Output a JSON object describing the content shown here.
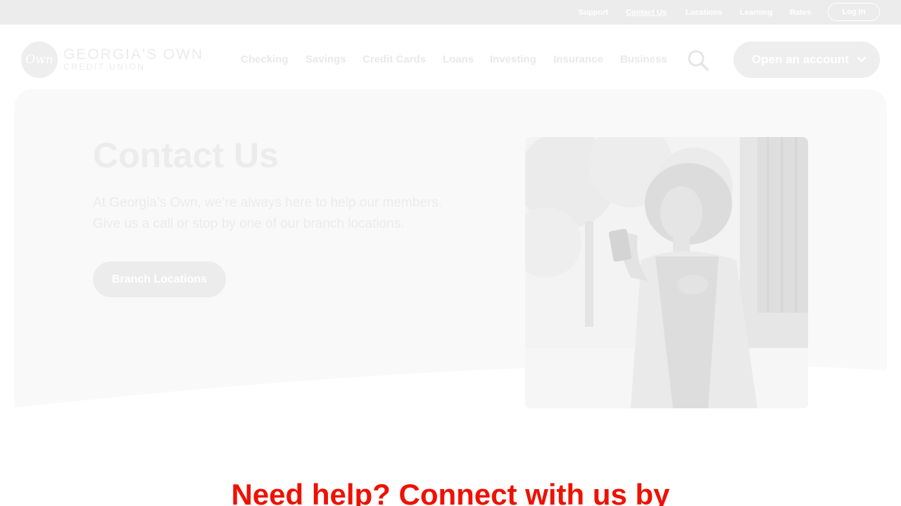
{
  "utility_nav": {
    "links": [
      {
        "label": "Support"
      },
      {
        "label": "Contact Us",
        "active": true
      },
      {
        "label": "Locations"
      },
      {
        "label": "Learning"
      },
      {
        "label": "Rates"
      }
    ],
    "login_label": "Log In"
  },
  "header": {
    "logo_mark": "Own",
    "logo_name": "GEORGIA'S OWN",
    "logo_sub": "CREDIT UNION",
    "nav": [
      "Checking",
      "Savings",
      "Credit Cards",
      "Loans",
      "Investing",
      "Insurance",
      "Business"
    ],
    "search_icon": "search-icon",
    "open_account_label": "Open an account",
    "open_account_icon": "chevron-down-icon"
  },
  "hero": {
    "title": "Contact Us",
    "body_line1": "At Georgia’s Own, we’re always here to help our members.",
    "body_line2": "Give us a call or stop by one of our branch locations.",
    "button_label": "Branch Locations"
  },
  "help_section": {
    "heading": "Need help? Connect with us by"
  },
  "colors": {
    "faded_text": "#ececec",
    "heading_red": "#ee1100",
    "utility_bar": "#ececec"
  }
}
